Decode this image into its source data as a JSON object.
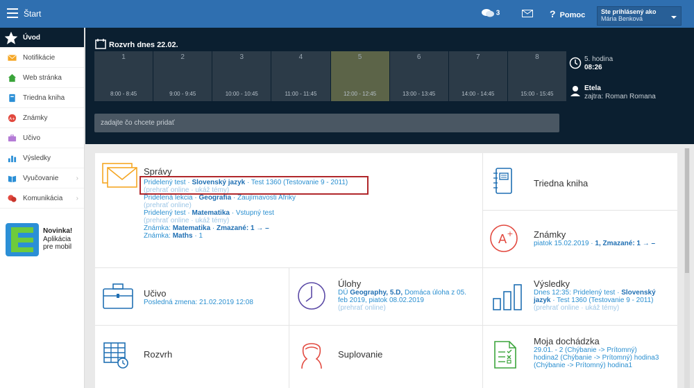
{
  "topbar": {
    "app_title": "Štart",
    "chat_count": "3",
    "help_label": "Pomoc",
    "user_status": "Ste prihlásený ako",
    "user_name": "Mária Benková"
  },
  "sidebar": {
    "items": [
      {
        "label": "Úvod",
        "icon": "star-icon"
      },
      {
        "label": "Notifikácie",
        "icon": "envelope-icon"
      },
      {
        "label": "Web stránka",
        "icon": "home-icon"
      },
      {
        "label": "Triedna kniha",
        "icon": "book-icon"
      },
      {
        "label": "Známky",
        "icon": "grade-icon"
      },
      {
        "label": "Učivo",
        "icon": "briefcase-icon"
      },
      {
        "label": "Výsledky",
        "icon": "bar-chart-icon"
      },
      {
        "label": "Vyučovanie",
        "icon": "open-book-icon"
      },
      {
        "label": "Komunikácia",
        "icon": "chat-icon"
      }
    ],
    "promo": {
      "title": "Novinka!",
      "line1": "Aplikácia",
      "line2": "pre mobil"
    }
  },
  "schedule": {
    "title": "Rozvrh dnes 22.02.",
    "slots": [
      {
        "num": "1",
        "time": "8:00 - 8:45"
      },
      {
        "num": "2",
        "time": "9:00 - 9:45"
      },
      {
        "num": "3",
        "time": "10:00 - 10:45"
      },
      {
        "num": "4",
        "time": "11:00 - 11:45"
      },
      {
        "num": "5",
        "time": "12:00 - 12:45"
      },
      {
        "num": "6",
        "time": "13:00 - 13:45"
      },
      {
        "num": "7",
        "time": "14:00 - 14:45"
      },
      {
        "num": "8",
        "time": "15:00 - 15:45"
      }
    ],
    "current_slot": "5",
    "input_placeholder": "zadajte čo chcete pridať",
    "current_lesson_label": "5. hodina",
    "current_time": "08:26",
    "person_name": "Etela",
    "person_note": "zajtra: Roman Romana"
  },
  "cards": {
    "spravy": {
      "title": "Správy",
      "m1_a": "Pridelený test · ",
      "m1_b": "Slovenský jazyk",
      "m1_c": " · Test 1360 (Testovanie 9 - 2011)",
      "m1_links": "(prehrať online · ukáž témy)",
      "m2_a": "Pridelená lekcia · ",
      "m2_b": "Geografia",
      "m2_c": " · Zaujímavosti Afriky",
      "m2_links": "(prehrať online)",
      "m3_a": "Pridelený test · ",
      "m3_b": "Matematika",
      "m3_c": " · Vstupný test",
      "m3_links": "(prehrať online · ukáž témy)",
      "m4_a": "Známka: ",
      "m4_b": "Matematika",
      "m4_c": " · ",
      "m4_d": "Zmazané: 1 → –",
      "m5_a": "Známka: ",
      "m5_b": "Maths",
      "m5_c": " · 1"
    },
    "triedna_kniha": {
      "title": "Triedna kniha"
    },
    "znamky": {
      "title": "Známky",
      "line_a": "piatok 15.02.2019 · ",
      "line_b": "1, Zmazané: 1 → –"
    },
    "ucivo": {
      "title": "Učivo",
      "line": "Posledná zmena: 21.02.2019 12:08"
    },
    "ulohy": {
      "title": "Úlohy",
      "l1_a": "DÚ ",
      "l1_b": "Geography, 5.D,",
      "l1_c": " Domáca úloha z 05.",
      "l2": "feb 2019, piatok 08.02.2019",
      "l3": "(prehrať online)"
    },
    "vysledky": {
      "title": "Výsledky",
      "l1_a": "Dnes 12:35: Pridelený test · ",
      "l1_b": "Slovenský",
      "l2_a": "jazyk",
      "l2_b": " · Test 1360 (Testovanie 9 - 2011)",
      "l3": "(prehrať online · ukáž témy)"
    },
    "rozvrh": {
      "title": "Rozvrh"
    },
    "suplovanie": {
      "title": "Suplovanie"
    },
    "dochadzka": {
      "title": "Moja dochádzka",
      "l1": "29.01. - 2 (Chýbanie -> Prítomný)",
      "l2": "hodina2 (Chýbanie -> Prítomný) hodina3",
      "l3": "(Chýbanie -> Prítomný) hodina1"
    }
  },
  "colors": {
    "topbar": "#2f6fb0",
    "dark_panel": "#0b1f30",
    "accent_orange": "#f5a623",
    "link_blue": "#2a8fd0",
    "highlight_red": "#b0262a"
  }
}
